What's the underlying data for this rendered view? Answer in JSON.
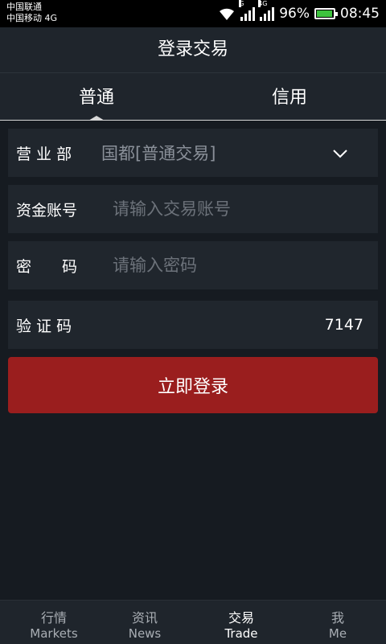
{
  "status_bar": {
    "carrier1": "中国联通",
    "carrier2": "中国移动 4G",
    "net1": "G",
    "net2": "4G",
    "battery": "96%",
    "battery_level": 0.96,
    "time": "08:45"
  },
  "header": {
    "title": "登录交易"
  },
  "tabs": [
    {
      "label": "普通",
      "active": true
    },
    {
      "label": "信用",
      "active": false
    }
  ],
  "form": {
    "branch": {
      "label": "营 业 部",
      "value": "国都[普通交易]"
    },
    "account": {
      "label": "资金账号",
      "placeholder": "请输入交易账号"
    },
    "password": {
      "label": "密　　码",
      "placeholder": "请输入密码"
    },
    "captcha": {
      "label": "验 证 码",
      "code": "7147"
    }
  },
  "login_button": {
    "label": "立即登录"
  },
  "bottom_nav": [
    {
      "cn": "行情",
      "en": "Markets"
    },
    {
      "cn": "资讯",
      "en": "News"
    },
    {
      "cn": "交易",
      "en": "Trade",
      "active": true
    },
    {
      "cn": "我",
      "en": "Me"
    }
  ],
  "colors": {
    "accent": "#9a1e1e",
    "background": "#161b21",
    "panel": "#20262d"
  }
}
